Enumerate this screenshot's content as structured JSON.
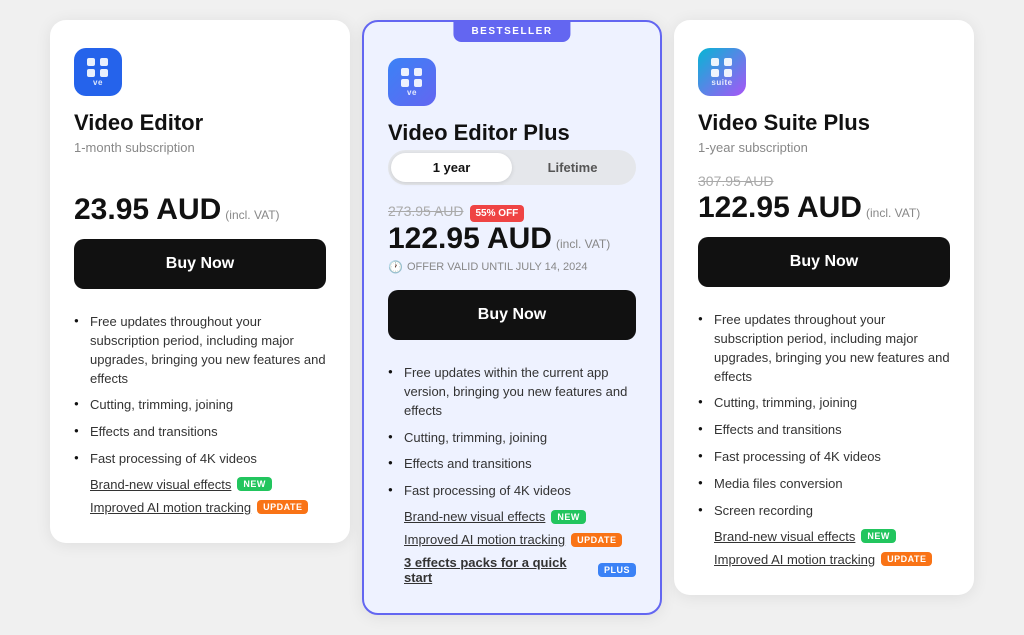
{
  "cards": [
    {
      "id": "video-editor",
      "featured": false,
      "icon_type": "blue",
      "icon_label": "ve",
      "title": "Video Editor",
      "subtitle": "1-month subscription",
      "show_toggle": false,
      "original_price": null,
      "discount": null,
      "price": "23.95 AUD",
      "price_note": "incl. VAT",
      "offer_valid": null,
      "buy_label": "Buy Now",
      "features": [
        "Free updates throughout your subscription period, including major upgrades, bringing you new features and effects",
        "Cutting, trimming, joining",
        "Effects and transitions",
        "Fast processing of 4K videos"
      ],
      "link_features": [
        {
          "text": "Brand-new visual effects",
          "badge": "NEW",
          "badge_type": "new",
          "bold": false
        },
        {
          "text": "Improved AI motion tracking",
          "badge": "UPDATE",
          "badge_type": "update",
          "bold": false
        }
      ]
    },
    {
      "id": "video-editor-plus",
      "featured": true,
      "bestseller": "BESTSELLER",
      "icon_type": "blue2",
      "icon_label": "ve",
      "title": "Video Editor Plus",
      "subtitle": null,
      "show_toggle": true,
      "toggle_options": [
        "1 year",
        "Lifetime"
      ],
      "toggle_active": "1 year",
      "original_price": "273.95 AUD",
      "discount": "55% OFF",
      "price": "122.95 AUD",
      "price_note": "incl. VAT",
      "offer_valid": "OFFER VALID UNTIL JULY 14, 2024",
      "buy_label": "Buy Now",
      "features": [
        "Free updates within the current app version, bringing you new features and effects",
        "Cutting, trimming, joining",
        "Effects and transitions",
        "Fast processing of 4K videos"
      ],
      "link_features": [
        {
          "text": "Brand-new visual effects",
          "badge": "NEW",
          "badge_type": "new",
          "bold": false
        },
        {
          "text": "Improved AI motion tracking",
          "badge": "UPDATE",
          "badge_type": "update",
          "bold": false
        },
        {
          "text": "3 effects packs for a quick start",
          "badge": "PLUS",
          "badge_type": "plus",
          "bold": true
        }
      ]
    },
    {
      "id": "video-suite-plus",
      "featured": false,
      "icon_type": "gradient",
      "icon_label": "suite",
      "title": "Video Suite Plus",
      "subtitle": "1-year subscription",
      "show_toggle": false,
      "original_price": "307.95 AUD",
      "discount": null,
      "price": "122.95 AUD",
      "price_note": "incl. VAT",
      "offer_valid": null,
      "buy_label": "Buy Now",
      "features": [
        "Free updates throughout your subscription period, including major upgrades, bringing you new features and effects",
        "Cutting, trimming, joining",
        "Effects and transitions",
        "Fast processing of 4K videos",
        "Media files conversion",
        "Screen recording"
      ],
      "link_features": [
        {
          "text": "Brand-new visual effects",
          "badge": "NEW",
          "badge_type": "new",
          "bold": false
        },
        {
          "text": "Improved AI motion tracking",
          "badge": "UPDATE",
          "badge_type": "update",
          "bold": false
        }
      ]
    }
  ]
}
